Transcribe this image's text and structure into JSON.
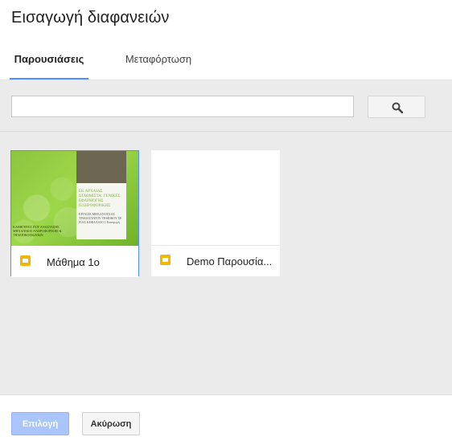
{
  "dialog": {
    "title": "Εισαγωγή διαφανειών"
  },
  "tabs": [
    {
      "label": "Παρουσιάσεις",
      "active": true
    },
    {
      "label": "Μεταφόρτωση",
      "active": false
    }
  ],
  "search": {
    "value": "",
    "icon": "search-icon"
  },
  "files": [
    {
      "name": "Μάθημα 1ο",
      "selected": true,
      "icon": "google-slides-icon",
      "thumbnail_text": {
        "title": "ΕΚ ΑΡΧΑΙΑΣ ΣΤΑΘΜΙΣΤΑ: ΓΕΝΙΚΕΣ ΕΦΑΡΜΟΓΗΣ ΠΛΗΡΟΦΟΡΙΚΗΣ",
        "subtitle": "ΕΡΓΑΣΙΑ ΜΗΧΑΝΟΥΣΑΣ ΤΡΙΔΙΑΣΤΑΤΟΥ ΓΡΑΦΙΚΟΥ ΣΕ ΡΙΑΣ ΚΕΦΑΛΑΙΟ 1 Εισαγωγή",
        "left_caption": "ΚΑΘΗΓΗΤΕΣ ΠΟΥ ΑΝΑΣΤΑΣΗΣ ΜΗΧΑΝΙΚΟΣ ΠΛΗΡΟΦΟΡΙΚΗΣ & ΤΗΛΕΠΙΚΟΙΝΩΝΙΩΝ"
      }
    },
    {
      "name": "Demo Παρουσία...",
      "selected": false,
      "icon": "google-slides-icon"
    }
  ],
  "footer": {
    "select_label": "Επιλογή",
    "cancel_label": "Ακύρωση"
  },
  "colors": {
    "accent": "#4d90fe",
    "slides_icon": "#f4b400",
    "select_button": "#a9c5fb"
  }
}
